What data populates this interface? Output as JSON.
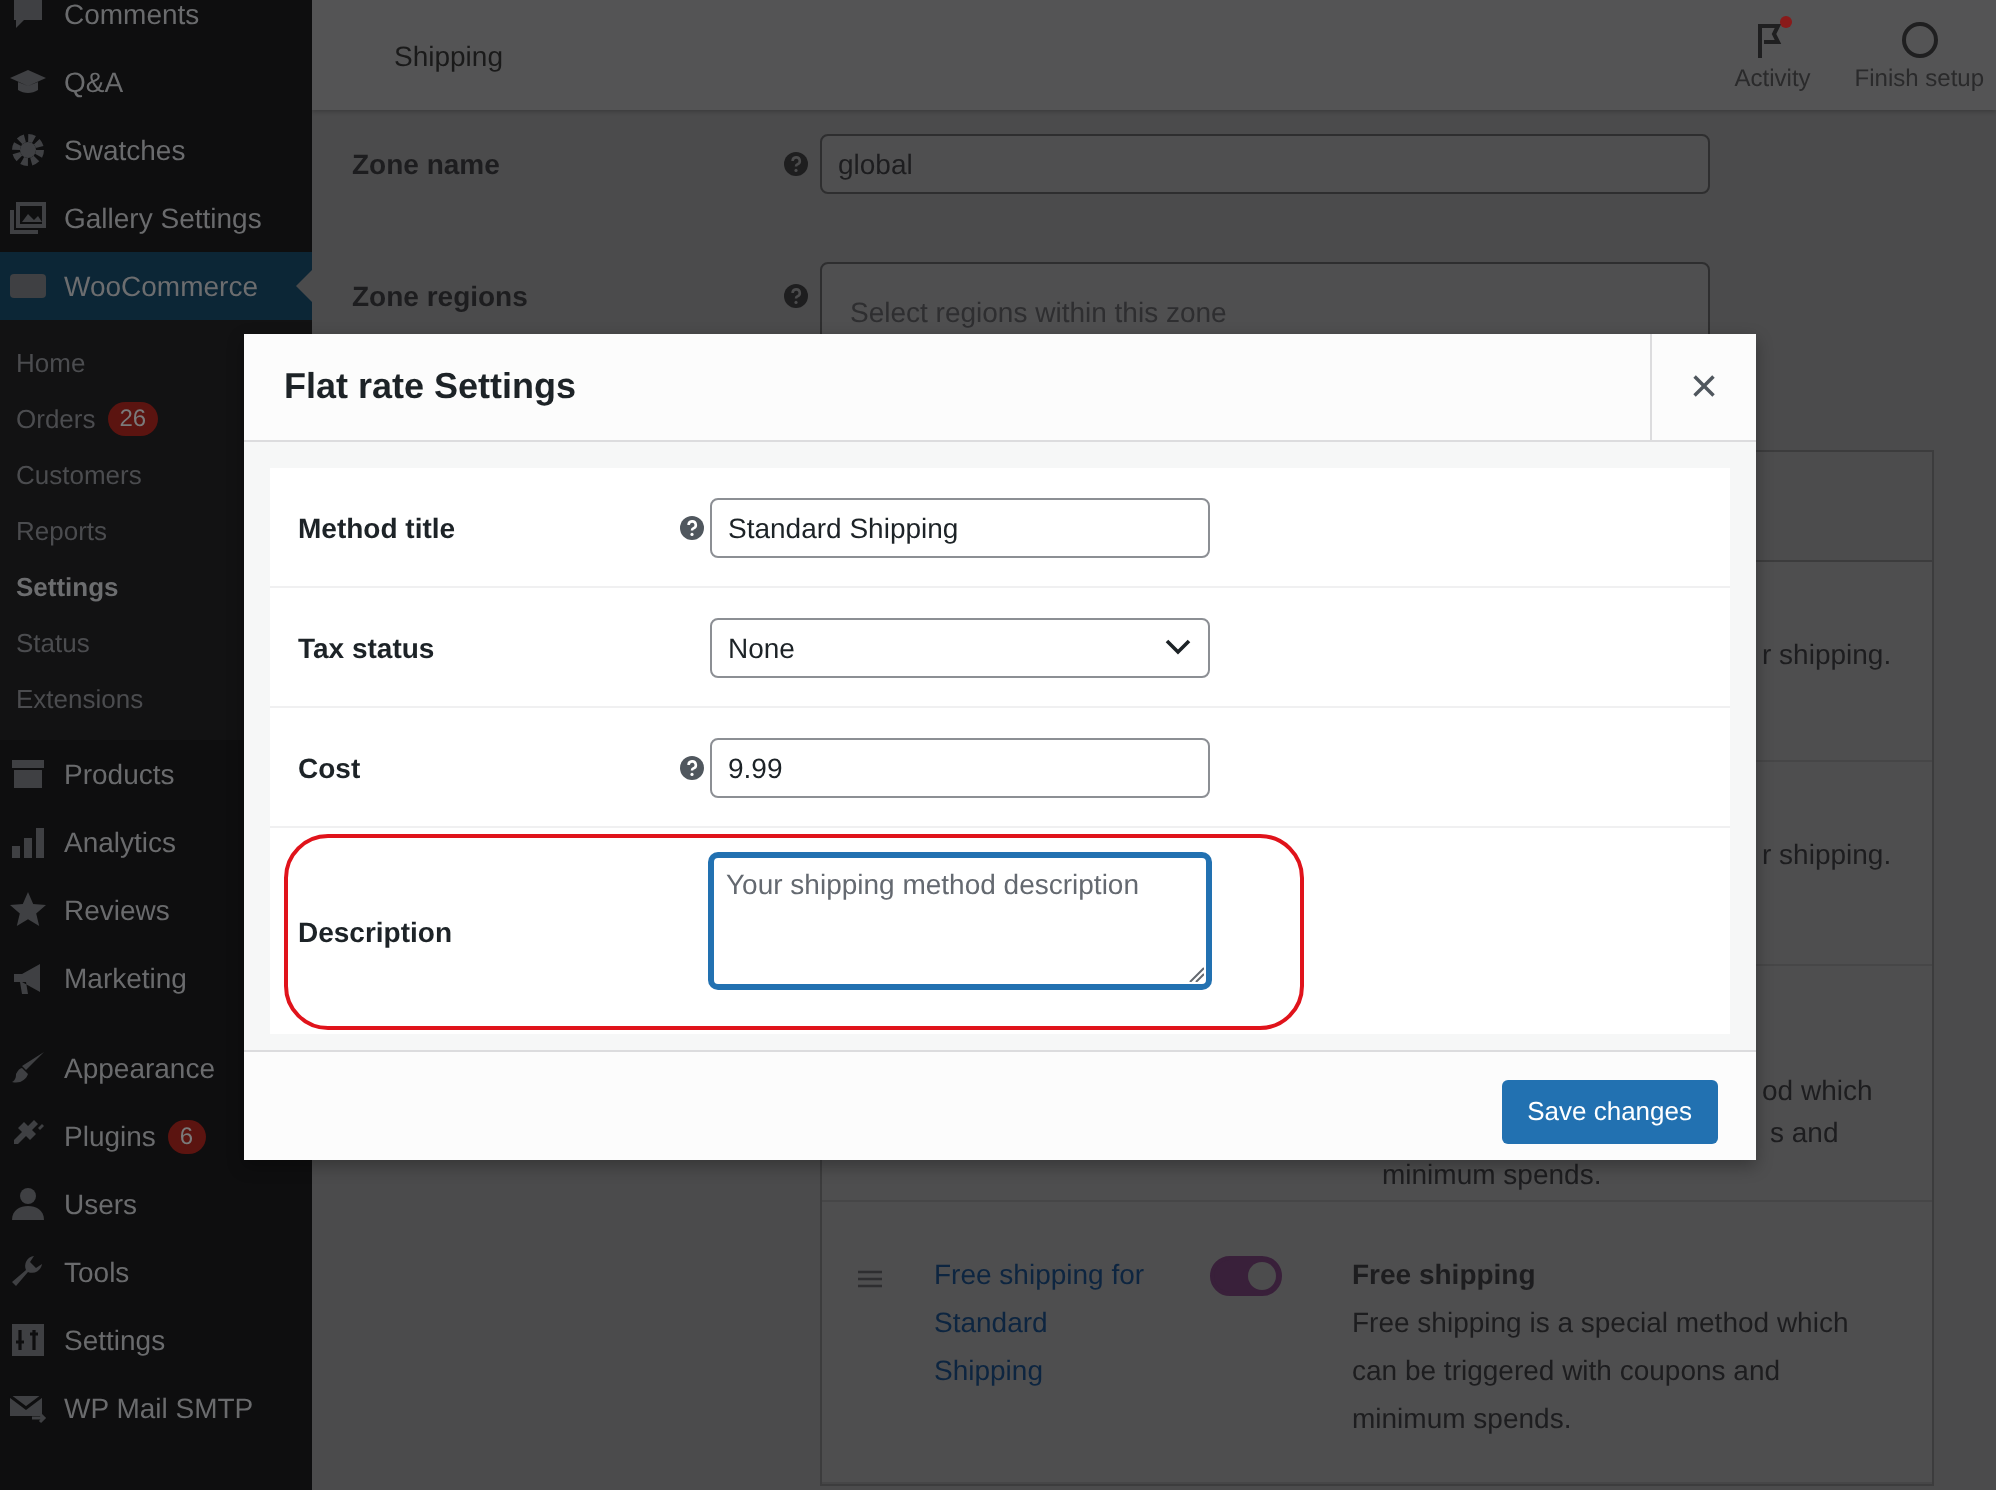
{
  "sidebar": {
    "groups": [
      [
        {
          "label": "Comments",
          "selected": false
        },
        {
          "label": "Q&A",
          "selected": false
        },
        {
          "label": "Swatches",
          "selected": false
        },
        {
          "label": "Gallery Settings",
          "selected": false
        },
        {
          "label": "WooCommerce",
          "selected": true,
          "children": [
            {
              "label": "Home",
              "selected": false
            },
            {
              "label": "Orders",
              "selected": false,
              "badge": "26"
            },
            {
              "label": "Customers",
              "selected": false
            },
            {
              "label": "Reports",
              "selected": false
            },
            {
              "label": "Settings",
              "selected": true
            },
            {
              "label": "Status",
              "selected": false
            },
            {
              "label": "Extensions",
              "selected": false
            }
          ]
        },
        {
          "label": "Products",
          "selected": false
        },
        {
          "label": "Analytics",
          "selected": false
        },
        {
          "label": "Reviews",
          "selected": false
        },
        {
          "label": "Marketing",
          "selected": false
        }
      ],
      [
        {
          "label": "Appearance",
          "selected": false
        },
        {
          "label": "Plugins",
          "selected": false,
          "badge": "6"
        },
        {
          "label": "Users",
          "selected": false
        },
        {
          "label": "Tools",
          "selected": false
        },
        {
          "label": "Settings",
          "selected": false
        },
        {
          "label": "WP Mail SMTP",
          "selected": false
        }
      ]
    ]
  },
  "header": {
    "title": "Shipping",
    "actions": [
      {
        "label": "Activity",
        "has_notification": true
      },
      {
        "label": "Finish setup",
        "has_notification": false
      }
    ]
  },
  "zone_form": {
    "fields": [
      {
        "label": "Zone name",
        "help": true,
        "value": "global"
      },
      {
        "label": "Zone regions",
        "help": true,
        "placeholder": "Select regions within this zone"
      }
    ]
  },
  "shipping_methods": {
    "rows": [
      {
        "kind": "partial",
        "lines": [
          {
            "text": "r shipping.",
            "clipped": true
          }
        ]
      },
      {
        "kind": "partial",
        "lines": [
          {
            "text": "r shipping.",
            "clipped": true
          }
        ]
      },
      {
        "kind": "partial",
        "lines": [
          {
            "text": "od which",
            "clipped": true
          },
          {
            "text": "s and",
            "clipped": true
          },
          {
            "text": "minimum spends.",
            "clipped": false
          }
        ]
      },
      {
        "kind": "full",
        "title": "Free shipping for Standard Shipping",
        "enabled": true,
        "method": "Free shipping",
        "description": "Free shipping is a special method which can be triggered with coupons and minimum spends."
      }
    ]
  },
  "modal": {
    "title": "Flat rate Settings",
    "close": "×",
    "fields": [
      {
        "kind": "text",
        "label": "Method title",
        "help": true,
        "value": "Standard Shipping",
        "focused": false,
        "highlighted": false
      },
      {
        "kind": "select",
        "label": "Tax status",
        "help": false,
        "value": "None",
        "focused": false,
        "highlighted": false
      },
      {
        "kind": "text",
        "label": "Cost",
        "help": true,
        "value": "9.99",
        "focused": false,
        "highlighted": false
      },
      {
        "kind": "textarea",
        "label": "Description",
        "help": false,
        "placeholder": "Your shipping method description",
        "focused": true,
        "highlighted": true
      }
    ],
    "save_button": "Save changes"
  }
}
